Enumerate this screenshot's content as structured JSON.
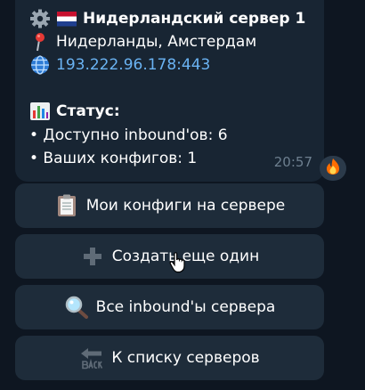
{
  "message": {
    "title": "Нидерландский сервер 1",
    "location": "Нидерланды, Амстердам",
    "address": "193.222.96.178:443",
    "status_heading": "Статус:",
    "inbounds_available": "• Доступно inbound'ов: 6",
    "your_configs": "• Ваших конфигов: 1",
    "time": "20:57"
  },
  "icons": {
    "title": [
      "gear-icon",
      "netherlands-flag-icon"
    ],
    "location": "pin-icon",
    "address": "globe-icon",
    "status": "chart-icon",
    "reaction": "fire-icon"
  },
  "buttons": [
    {
      "label": "Мои конфиги на сервере",
      "icon": "clipboard-icon"
    },
    {
      "label": "Создать еще один",
      "icon": "plus-icon"
    },
    {
      "label": "Все inbound'ы сервера",
      "icon": "magnifier-icon"
    },
    {
      "label": "К списку серверов",
      "icon": "back-arrow-icon"
    }
  ],
  "colors": {
    "background": "#0e1621",
    "bubble": "#182533",
    "button": "#1e2c3a",
    "link": "#6ab3f3",
    "time": "#6d7f8f"
  }
}
